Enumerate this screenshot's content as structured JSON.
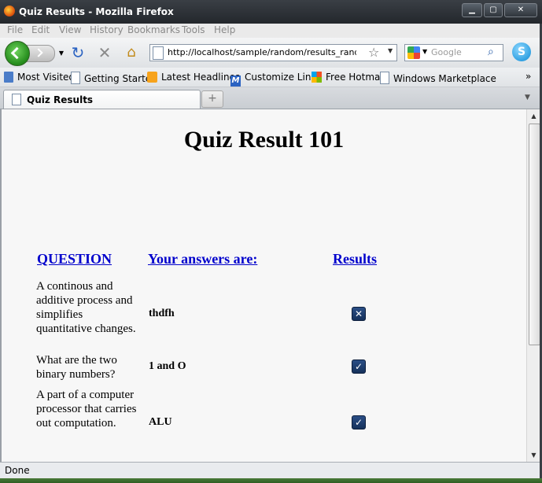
{
  "window": {
    "title": "Quiz Results - Mozilla Firefox",
    "minimize_icon": "minimize-icon",
    "maximize_icon": "maximize-icon",
    "close_icon": "close-icon"
  },
  "menubar": {
    "items": [
      "File",
      "Edit",
      "View",
      "History",
      "Bookmarks",
      "Tools",
      "Help"
    ]
  },
  "navbar": {
    "url": "http://localhost/sample/random/results_random.php",
    "search_placeholder": "Google"
  },
  "bookmarks": {
    "items": [
      "Most Visited",
      "Getting Started",
      "Latest Headlines",
      "Customize Links",
      "Free Hotmail",
      "Windows Marketplace"
    ],
    "more": "»"
  },
  "tabs": {
    "active_label": "Quiz Results",
    "new_tab": "+"
  },
  "page": {
    "title": "Quiz Result 101",
    "headers": {
      "question": "QUESTION",
      "answers": "Your answers are:",
      "results": "Results"
    },
    "rows": [
      {
        "question": "A continous and additive process and simplifies quantitative changes.",
        "answer": "thdfh",
        "result": "wrong",
        "mark": "✕"
      },
      {
        "question": "What are the two binary numbers?",
        "answer": "1 and O",
        "result": "correct",
        "mark": "✓"
      },
      {
        "question": "A part of a computer processor that carries out computation.",
        "answer": "ALU",
        "result": "correct",
        "mark": "✓"
      }
    ]
  },
  "status": {
    "text": "Done"
  },
  "colors": {
    "link": "#0000cc",
    "check_bg": "#1f3f72"
  }
}
